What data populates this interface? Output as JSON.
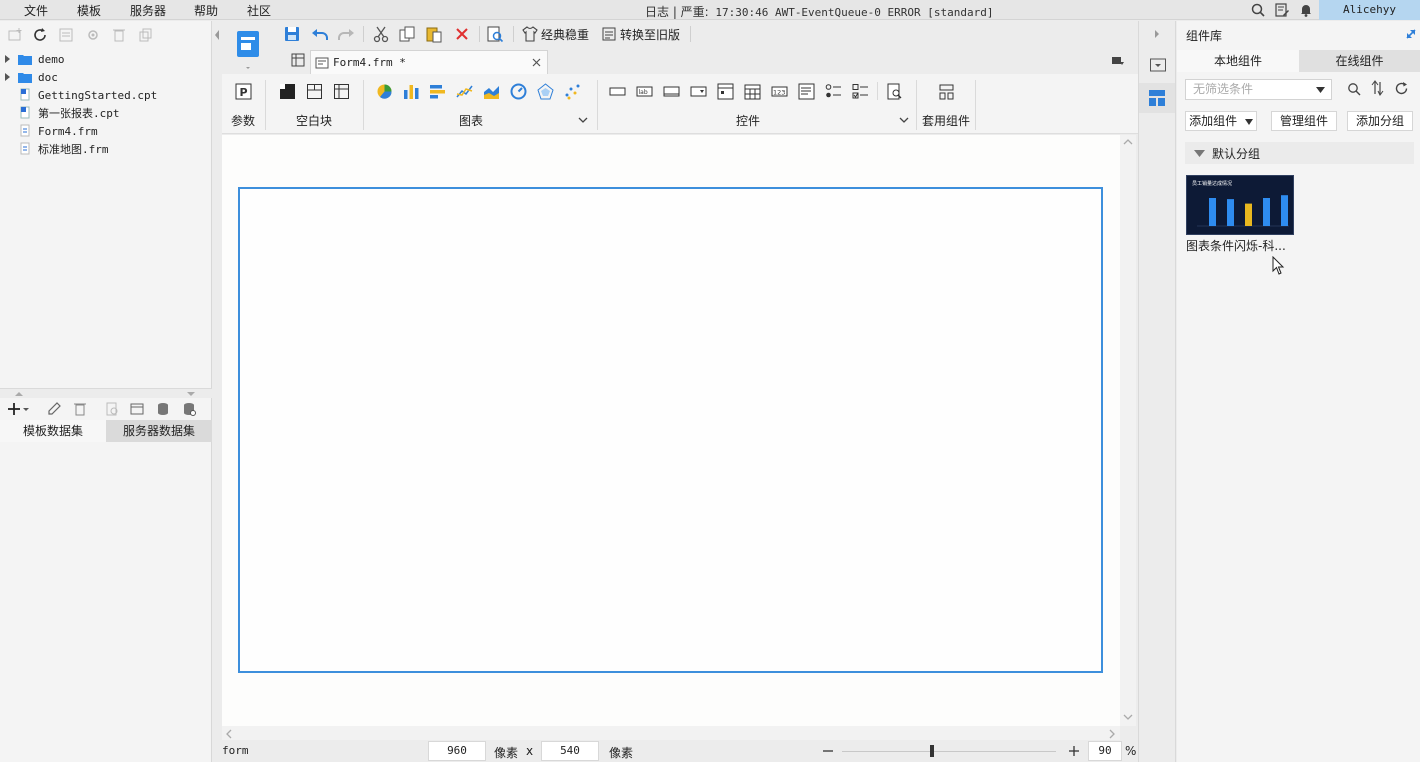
{
  "menubar": {
    "items": [
      "文件",
      "模板",
      "服务器",
      "帮助",
      "社区"
    ],
    "log_prefix": "日志 | 严重:",
    "log_message": "17:30:46 AWT-EventQueue-0 ERROR [standard]",
    "user": "Alicehyy"
  },
  "file_tree": [
    {
      "name": "demo",
      "type": "folder"
    },
    {
      "name": "doc",
      "type": "folder"
    },
    {
      "name": "GettingStarted.cpt",
      "type": "cpt"
    },
    {
      "name": "第一张报表.cpt",
      "type": "cpt"
    },
    {
      "name": "Form4.frm",
      "type": "frm"
    },
    {
      "name": "标准地图.frm",
      "type": "frm"
    }
  ],
  "dataset_tabs": [
    "模板数据集",
    "服务器数据集"
  ],
  "toolbar": {
    "classic_label": "经典稳重",
    "convert_label": "转换至旧版"
  },
  "doc_tab": {
    "title": "Form4.frm *"
  },
  "ribbon": {
    "param_label": "参数",
    "blank_label": "空白块",
    "chart_label": "图表",
    "control_label": "控件",
    "template_comp_label": "套用组件"
  },
  "statusbar": {
    "mode": "form",
    "width": "960",
    "unit1": "像素",
    "times": "x",
    "height": "540",
    "unit2": "像素",
    "zoom_value": "90",
    "zoom_unit": "%"
  },
  "right_panel": {
    "title": "组件库",
    "tabs": [
      "本地组件",
      "在线组件"
    ],
    "filter_placeholder": "无筛选条件",
    "add_component": "添加组件",
    "manage_component": "管理组件",
    "add_group": "添加分组",
    "group_name": "默认分组",
    "component_name": "图表条件闪烁-科...",
    "thumb_title": "员工销量达成情况",
    "thumb_bar_levels": [
      0.5,
      0.48,
      0.4,
      0.5,
      0.55
    ]
  },
  "colors": {
    "accent": "#3d8fdc",
    "user_badge": "#b5d6f0",
    "thumb_bg": "#0d1a36",
    "bar_blue": "#2e8cf0",
    "bar_gold": "#e8b820"
  }
}
